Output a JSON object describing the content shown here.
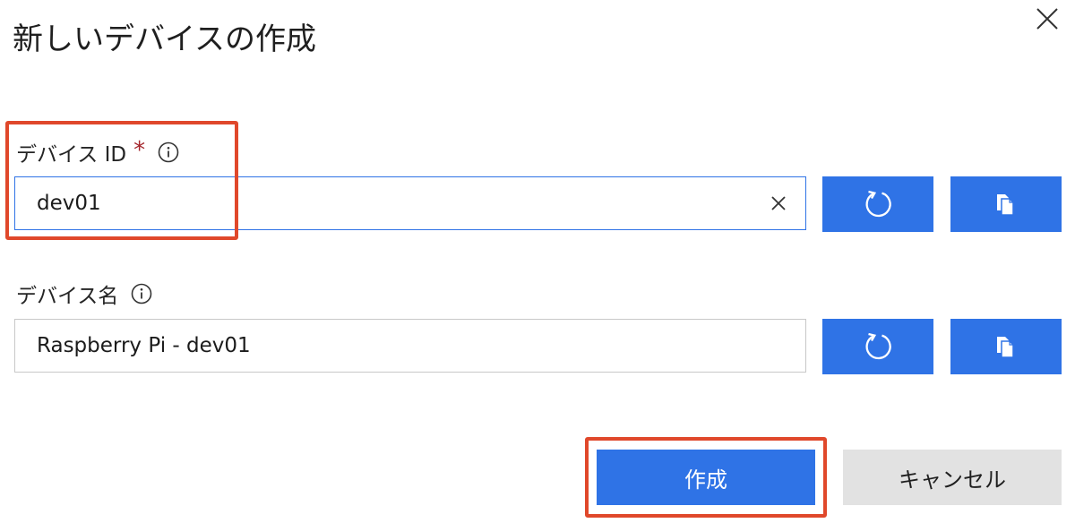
{
  "dialog": {
    "title": "新しいデバイスの作成"
  },
  "device_id": {
    "label": "デバイス ID",
    "required_mark": "*",
    "value": "dev01"
  },
  "device_name": {
    "label": "デバイス名",
    "value": "Raspberry Pi - dev01"
  },
  "footer": {
    "create_label": "作成",
    "cancel_label": "キャンセル"
  },
  "colors": {
    "primary": "#2f73e6",
    "required": "#a4262c",
    "highlight": "#e0482b",
    "secondary_button": "#e2e2e2"
  },
  "icons": {
    "close": "close-icon",
    "info": "info-icon",
    "clear": "clear-icon",
    "regenerate": "refresh-icon",
    "copy": "copy-icon"
  }
}
